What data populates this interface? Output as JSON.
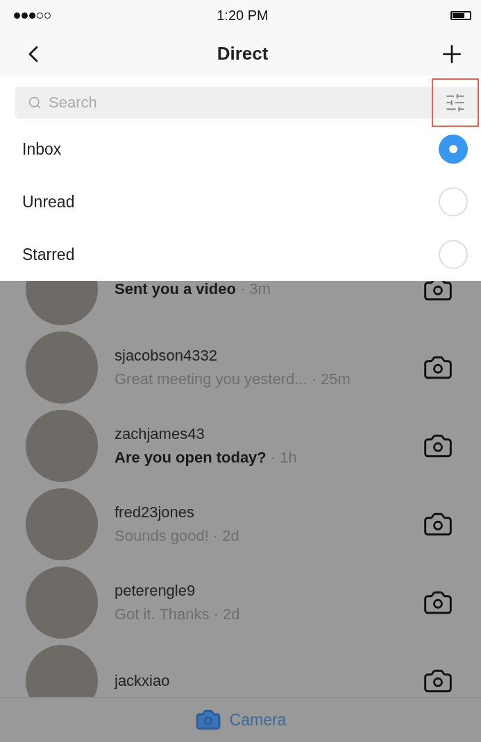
{
  "status_bar": {
    "time": "1:20 PM"
  },
  "nav": {
    "title": "Direct"
  },
  "search": {
    "placeholder": "Search"
  },
  "filter_button": {
    "highlighted": true
  },
  "filter_options": [
    {
      "label": "Inbox",
      "selected": true
    },
    {
      "label": "Unread",
      "selected": false
    },
    {
      "label": "Starred",
      "selected": false
    }
  ],
  "conversations": [
    {
      "message": "Sent you a video",
      "time": "· 3m",
      "unread": true
    },
    {
      "name": "sjacobson4332",
      "message": "Great meeting you yesterd...",
      "time": "· 25m",
      "unread": false
    },
    {
      "name": "zachjames43",
      "message": "Are you open today?",
      "time": "· 1h",
      "unread": true
    },
    {
      "name": "fred23jones",
      "message": "Sounds good!",
      "time": "· 2d",
      "unread": false
    },
    {
      "name": "peterengle9",
      "message": "Got it. Thanks",
      "time": "· 2d",
      "unread": false
    },
    {
      "name": "jackxiao"
    }
  ],
  "bottom_bar": {
    "label": "Camera"
  }
}
